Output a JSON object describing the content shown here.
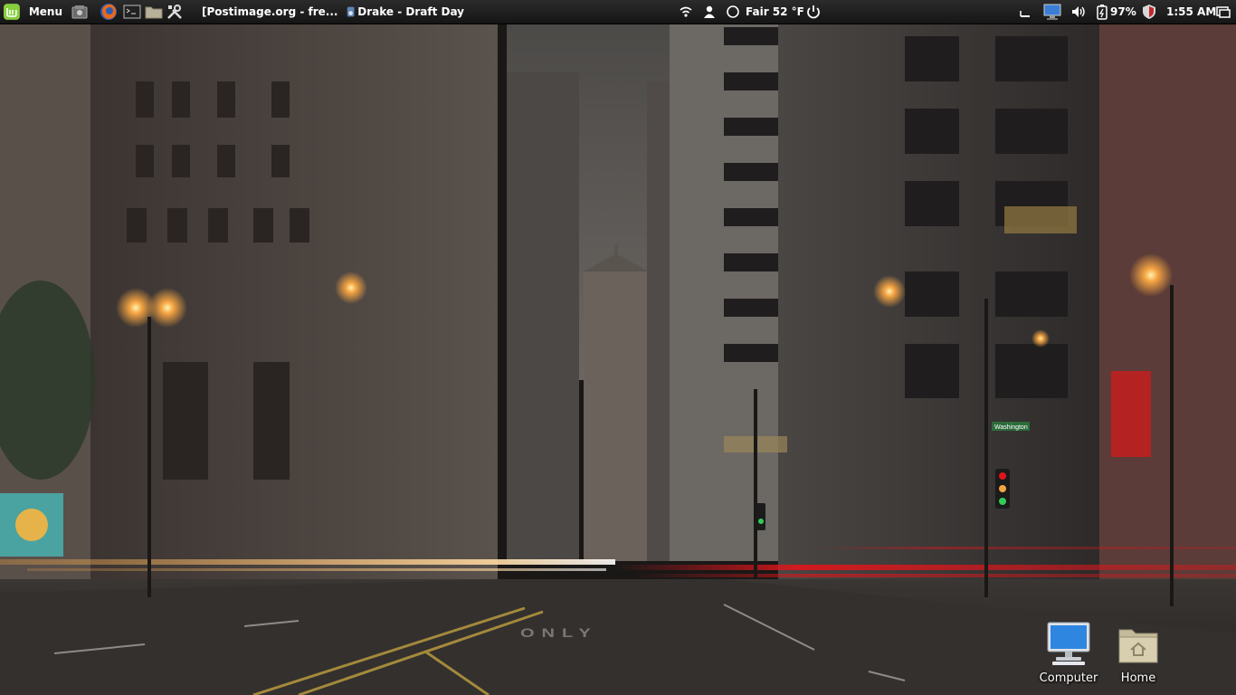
{
  "panel": {
    "menu_label": "Menu",
    "launchers": [
      {
        "icon": "files-icon"
      },
      {
        "icon": "firefox-icon"
      },
      {
        "icon": "terminal-icon"
      },
      {
        "icon": "folder-icon"
      },
      {
        "icon": "settings-tools-icon"
      }
    ],
    "tasks": [
      {
        "title": "[Postimage.org - fre...",
        "icon": "firefox-icon"
      },
      {
        "title": "Drake - Draft Day",
        "icon": "audio-player-icon"
      }
    ],
    "weather": "Fair 52 °F",
    "battery": "97%",
    "clock": "1:55 AM",
    "tray_icons": [
      "wifi-icon",
      "user-icon",
      "weather-icon",
      "power-icon",
      "window-list-icon",
      "network-monitor-icon",
      "volume-icon",
      "battery-icon",
      "shield-icon",
      "show-desktop-icon"
    ]
  },
  "desktop": {
    "icons": [
      {
        "label": "Computer",
        "icon": "computer-icon"
      },
      {
        "label": "Home",
        "icon": "home-folder-icon"
      }
    ],
    "wallpaper": "hdr-city-street-night",
    "road_marking": "ONLY",
    "street_sign": "Washington"
  },
  "colors": {
    "panel_bg": "#1d1d1d",
    "mint_green": "#87cf3e",
    "accent_warm": "#f5a442",
    "tail_light_red": "#e0151a"
  }
}
